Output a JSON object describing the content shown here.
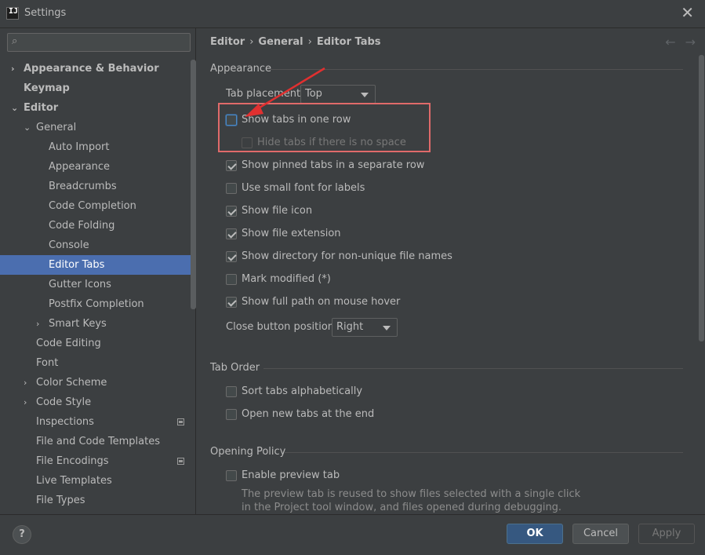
{
  "window": {
    "title": "Settings",
    "app_icon_text": "IJ"
  },
  "search": {
    "placeholder": "",
    "value": ""
  },
  "sidebar": {
    "items": [
      {
        "label": "Appearance & Behavior",
        "level": 0,
        "arrow": "›",
        "bold": true
      },
      {
        "label": "Keymap",
        "level": 0,
        "arrow": "",
        "bold": true
      },
      {
        "label": "Editor",
        "level": 0,
        "arrow": "⌄",
        "bold": true
      },
      {
        "label": "General",
        "level": 1,
        "arrow": "⌄"
      },
      {
        "label": "Auto Import",
        "level": 2
      },
      {
        "label": "Appearance",
        "level": 2
      },
      {
        "label": "Breadcrumbs",
        "level": 2
      },
      {
        "label": "Code Completion",
        "level": 2
      },
      {
        "label": "Code Folding",
        "level": 2
      },
      {
        "label": "Console",
        "level": 2
      },
      {
        "label": "Editor Tabs",
        "level": 2,
        "selected": true
      },
      {
        "label": "Gutter Icons",
        "level": 2
      },
      {
        "label": "Postfix Completion",
        "level": 2
      },
      {
        "label": "Smart Keys",
        "level": 2,
        "arrow": "›"
      },
      {
        "label": "Code Editing",
        "level": 1
      },
      {
        "label": "Font",
        "level": 1
      },
      {
        "label": "Color Scheme",
        "level": 1,
        "arrow": "›"
      },
      {
        "label": "Code Style",
        "level": 1,
        "arrow": "›"
      },
      {
        "label": "Inspections",
        "level": 1,
        "badge": true
      },
      {
        "label": "File and Code Templates",
        "level": 1
      },
      {
        "label": "File Encodings",
        "level": 1,
        "badge": true
      },
      {
        "label": "Live Templates",
        "level": 1
      },
      {
        "label": "File Types",
        "level": 1
      }
    ]
  },
  "breadcrumb": {
    "part1": "Editor",
    "part2": "General",
    "part3": "Editor Tabs",
    "sep": "›"
  },
  "nav": {
    "back": "←",
    "forward": "→"
  },
  "appearance": {
    "title": "Appearance",
    "tab_placement_label": "Tab placement:",
    "tab_placement_value": "Top",
    "checkboxes": [
      {
        "label": "Show tabs in one row",
        "checked": false,
        "focused": true
      },
      {
        "label": "Hide tabs if there is no space",
        "checked": false,
        "disabled": true
      },
      {
        "label": "Show pinned tabs in a separate row",
        "checked": true
      },
      {
        "label": "Use small font for labels",
        "checked": false
      },
      {
        "label": "Show file icon",
        "checked": true
      },
      {
        "label": "Show file extension",
        "checked": true
      },
      {
        "label": "Show directory for non-unique file names",
        "checked": true
      },
      {
        "label": "Mark modified (*)",
        "checked": false
      },
      {
        "label": "Show full path on mouse hover",
        "checked": true
      }
    ],
    "close_button_label": "Close button position:",
    "close_button_value": "Right"
  },
  "tab_order": {
    "title": "Tab Order",
    "checkboxes": [
      {
        "label": "Sort tabs alphabetically",
        "checked": false
      },
      {
        "label": "Open new tabs at the end",
        "checked": false
      }
    ]
  },
  "opening_policy": {
    "title": "Opening Policy",
    "checkbox": {
      "label": "Enable preview tab",
      "checked": false
    },
    "help_line1": "The preview tab is reused to show files selected with a single click",
    "help_line2": "in the Project tool window, and files opened during debugging."
  },
  "footer": {
    "help": "?",
    "ok": "OK",
    "cancel": "Cancel",
    "apply": "Apply"
  },
  "colors": {
    "accent_selected": "#4b6eaf",
    "annotation_red": "#e06a6a",
    "ok_button": "#365880"
  }
}
